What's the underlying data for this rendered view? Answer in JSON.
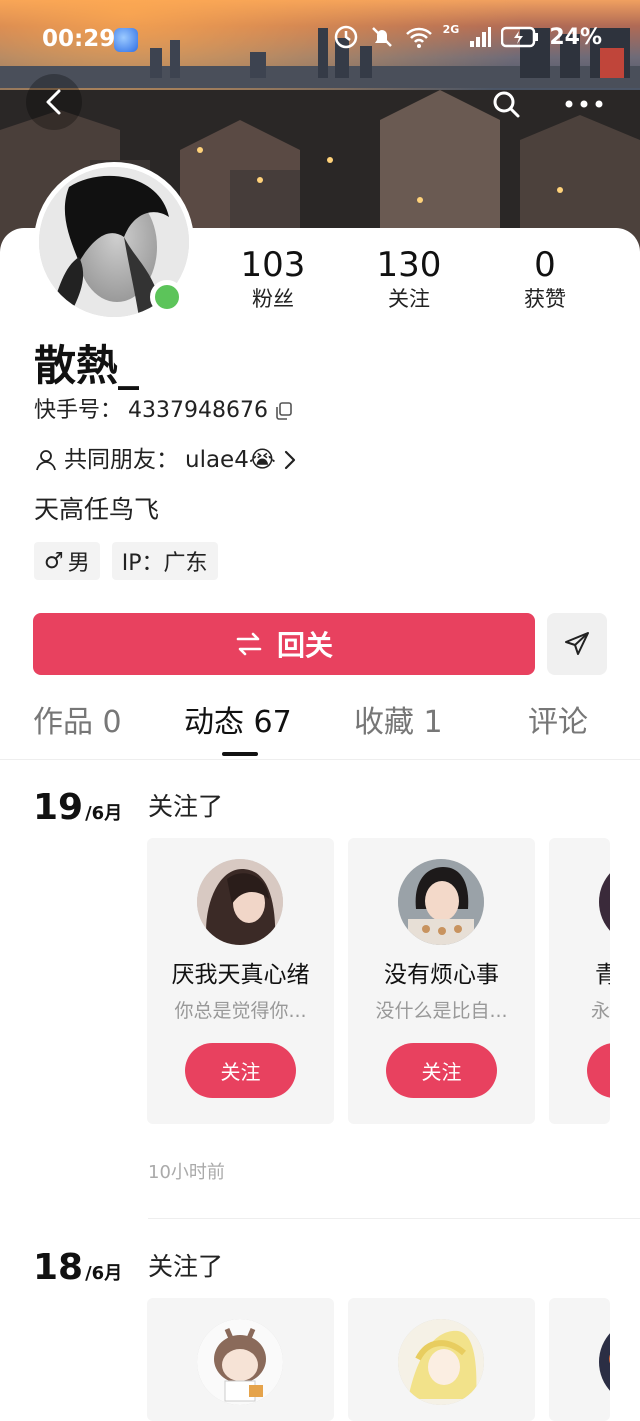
{
  "status_bar": {
    "time": "00:29",
    "network": "2G",
    "battery": "24%"
  },
  "profile": {
    "name": "散熱_",
    "id_label": "快手号：",
    "id_value": "4337948676",
    "mutual_label": "共同朋友：",
    "mutual_value": "ulae4😭",
    "bio": "天高任鸟飞",
    "gender_symbol": "♂",
    "gender": "男",
    "ip": "IP：广东"
  },
  "stats": [
    {
      "value": "103",
      "label": "粉丝"
    },
    {
      "value": "130",
      "label": "关注"
    },
    {
      "value": "0",
      "label": "获赞"
    }
  ],
  "actions": {
    "follow_back_label": "回关",
    "follow_back_icon": "⇄"
  },
  "tabs": [
    {
      "label": "作品 0"
    },
    {
      "label": "动态 67"
    },
    {
      "label": "收藏 1"
    },
    {
      "label": "评论"
    }
  ],
  "feed": [
    {
      "day": "19",
      "month": "/6月",
      "action": "关注了",
      "time_ago": "10小时前",
      "users": [
        {
          "name": "厌我天真心绪",
          "desc": "你总是觉得你...",
          "button": "关注"
        },
        {
          "name": "没有烦心事",
          "desc": "没什么是比自...",
          "button": "关注"
        },
        {
          "name": "青",
          "desc": "永",
          "button": "关注"
        }
      ]
    },
    {
      "day": "18",
      "month": "/6月",
      "action": "关注了",
      "users": []
    }
  ],
  "colors": {
    "accent": "#e8415f",
    "online": "#5cc45a"
  },
  "icons": [
    "back-icon",
    "search-icon",
    "more-icon",
    "copy-icon",
    "person-icon",
    "chevron-right-icon",
    "male-icon",
    "swap-icon",
    "send-icon"
  ]
}
